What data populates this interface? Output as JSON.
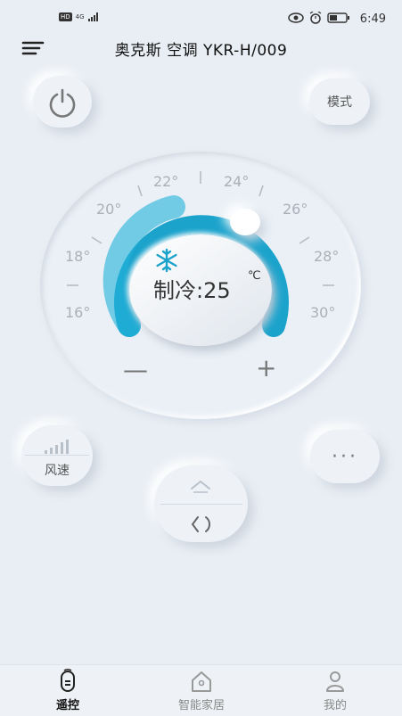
{
  "status_bar": {
    "hd": "HD",
    "network": "4G",
    "time": "6:49"
  },
  "header": {
    "title": "奥克斯 空调 YKR-H/009",
    "menu_icon": "menu-icon"
  },
  "controls": {
    "power_icon": "power-icon",
    "mode_label": "模式",
    "wind_label": "风速",
    "more_label": "···",
    "minus_label": "—",
    "plus_label": "+"
  },
  "dial": {
    "ticks": [
      "22°",
      "24°",
      "20°",
      "26°",
      "18°",
      "28°",
      "16°",
      "30°"
    ],
    "mode_text": "制冷:25",
    "unit": "℃",
    "mode_icon": "snowflake-icon",
    "set_temperature": 25
  },
  "tabs": [
    {
      "label": "遥控",
      "icon": "remote-icon",
      "active": true
    },
    {
      "label": "智能家居",
      "icon": "home-icon",
      "active": false
    },
    {
      "label": "我的",
      "icon": "user-icon",
      "active": false
    }
  ],
  "colors": {
    "accent": "#1ba3cc",
    "background": "#e9eef4",
    "tick": "#a9b0b9"
  }
}
